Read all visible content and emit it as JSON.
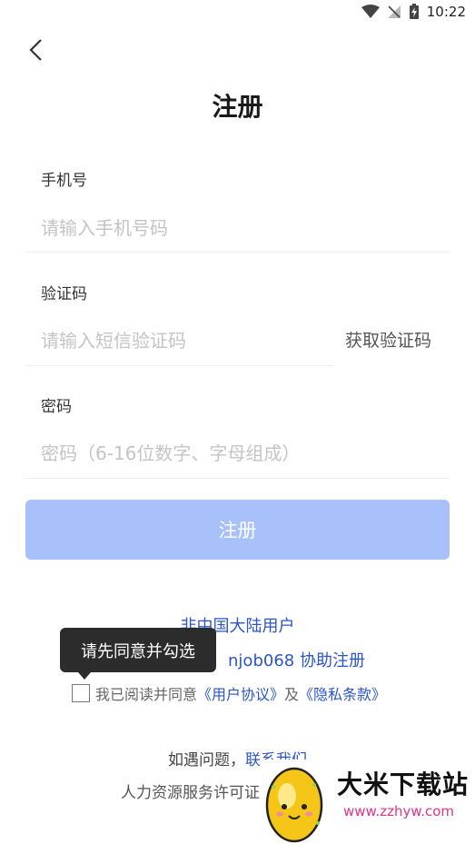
{
  "status_bar": {
    "time": "10:22"
  },
  "page": {
    "title": "注册"
  },
  "phone": {
    "label": "手机号",
    "placeholder": "请输入手机号码"
  },
  "code": {
    "label": "验证码",
    "placeholder": "请输入短信验证码",
    "get_code_label": "获取验证码"
  },
  "password": {
    "label": "密码",
    "placeholder": "密码（6-16位数字、字母组成）"
  },
  "submit": {
    "label": "注册",
    "color": "#a9c1fb"
  },
  "links": {
    "non_mainland": "非中国大陆用户",
    "assist_prefix": "njob068",
    "assist_suffix": "协助注册"
  },
  "tooltip": {
    "text": "请先同意并勾选"
  },
  "agreement": {
    "prefix": "我已阅读并同意",
    "user_agreement": "《用户协议》",
    "and": "及",
    "privacy": "《隐私条款》"
  },
  "help": {
    "prefix": "如遇问题，",
    "contact": "联系我们"
  },
  "license": {
    "text": "人力资源服务许可证"
  },
  "watermark": {
    "name": "大米下载站",
    "url": "www.zzhyw.com"
  },
  "colors": {
    "link": "#2b55c8",
    "accent": "#a9c1fb"
  }
}
